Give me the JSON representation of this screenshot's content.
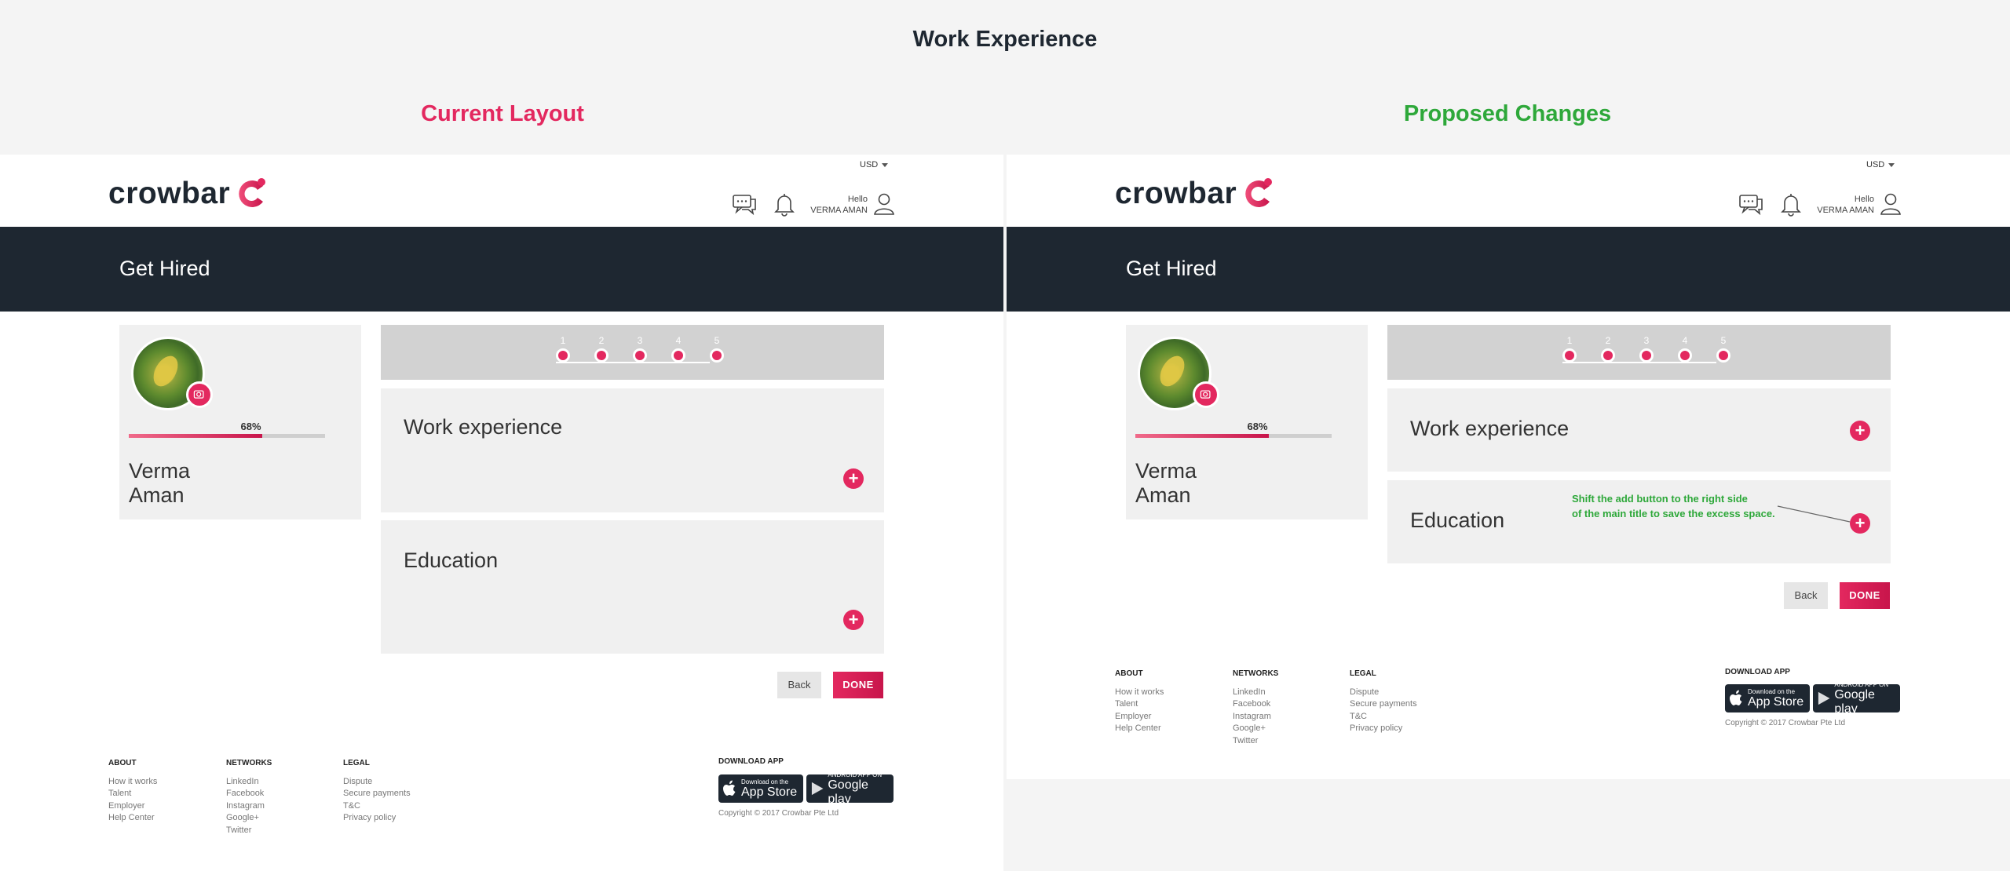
{
  "page": {
    "title": "Work Experience",
    "left_heading": "Current Layout",
    "right_heading": "Proposed Changes"
  },
  "header": {
    "currency": "USD",
    "logo_text": "crowbar",
    "hello": "Hello",
    "user_name": "VERMA AMAN"
  },
  "banner": {
    "title": "Get Hired"
  },
  "profile": {
    "progress_label": "68%",
    "progress": 0.68,
    "first_name": "Verma",
    "last_name": "Aman"
  },
  "stepper": {
    "steps": [
      "1",
      "2",
      "3",
      "4",
      "5"
    ]
  },
  "sections": {
    "work": "Work experience",
    "education": "Education",
    "add_symbol": "+"
  },
  "buttons": {
    "back": "Back",
    "done": "DONE"
  },
  "annotation": {
    "line1": "Shift the add button to the right side",
    "line2": "of the main title to save the excess space."
  },
  "footer": {
    "about": {
      "heading": "ABOUT",
      "items": [
        "How it works",
        "Talent",
        "Employer",
        "Help Center"
      ]
    },
    "networks": {
      "heading": "NETWORKS",
      "items": [
        "LinkedIn",
        "Facebook",
        "Instagram",
        "Google+",
        "Twitter"
      ]
    },
    "legal": {
      "heading": "LEGAL",
      "items": [
        "Dispute",
        "Secure payments",
        "T&C",
        "Privacy policy"
      ]
    },
    "download_heading": "DOWNLOAD APP",
    "app_store_small": "Download on the",
    "app_store_big": "App Store",
    "google_small": "ANDROID APP ON",
    "google_big": "Google play",
    "copyright": "Copyright © 2017 Crowbar Pte Ltd"
  },
  "colors": {
    "brand_pink": "#e3285f",
    "dark_navy": "#1e2731",
    "proposal_green": "#2ea83a"
  }
}
